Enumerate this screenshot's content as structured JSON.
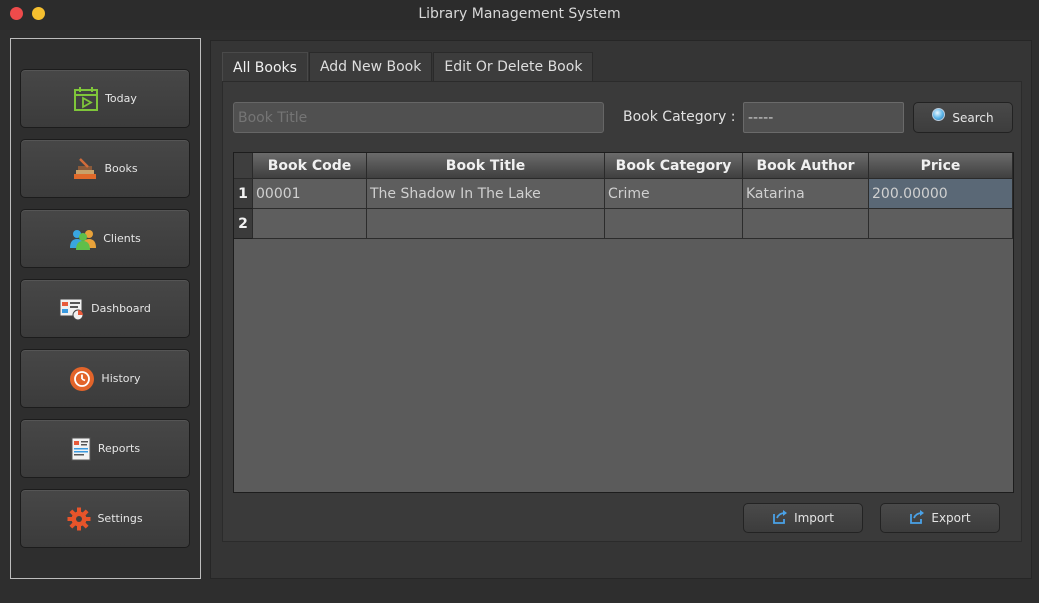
{
  "window": {
    "title": "Library Management System"
  },
  "sidebar": {
    "items": [
      {
        "label": "Today",
        "icon": "calendar-icon"
      },
      {
        "label": "Books",
        "icon": "books-icon"
      },
      {
        "label": "Clients",
        "icon": "users-icon"
      },
      {
        "label": "Dashboard",
        "icon": "dashboard-icon"
      },
      {
        "label": "History",
        "icon": "history-icon"
      },
      {
        "label": "Reports",
        "icon": "reports-icon"
      },
      {
        "label": "Settings",
        "icon": "gear-icon"
      }
    ]
  },
  "tabs": [
    {
      "label": "All Books",
      "active": true
    },
    {
      "label": "Add New Book",
      "active": false
    },
    {
      "label": "Edit Or Delete Book",
      "active": false
    }
  ],
  "filters": {
    "title_placeholder": "Book Title",
    "category_label": "Book Category :",
    "category_value": "-----",
    "search_label": "Search"
  },
  "table": {
    "columns": [
      "Book Code",
      "Book Title",
      "Book Category",
      "Book Author",
      "Price"
    ],
    "row_numbers": [
      "1",
      "2"
    ],
    "rows": [
      [
        "00001",
        "The Shadow In The Lake",
        "Crime",
        "Katarina",
        "200.00000"
      ],
      [
        "",
        "",
        "",
        "",
        ""
      ]
    ]
  },
  "actions": {
    "import_label": "Import",
    "export_label": "Export"
  },
  "colors": {
    "background": "#2e2e2e",
    "panel": "#3a3a3a",
    "grid": "#5b5b5b",
    "selected_cell": "#5a6876"
  }
}
